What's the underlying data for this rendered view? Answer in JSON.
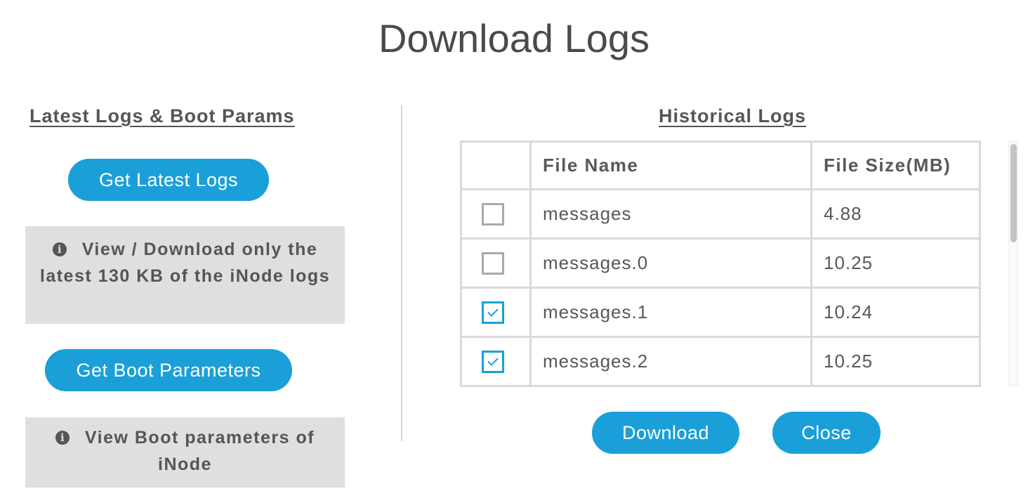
{
  "page": {
    "title": "Download Logs"
  },
  "left": {
    "heading": "Latest Logs & Boot Params",
    "get_latest_logs_label": "Get Latest Logs",
    "latest_info_text": "View / Download only the latest 130 KB of the iNode logs",
    "get_boot_params_label": "Get Boot Parameters",
    "boot_info_text": "View Boot parameters of iNode",
    "info_icon": "info-icon"
  },
  "right": {
    "heading": "Historical Logs",
    "columns": {
      "file_name": "File Name",
      "file_size": "File Size(MB)"
    },
    "rows": [
      {
        "name": "messages",
        "size": "4.88",
        "checked": false
      },
      {
        "name": "messages.0",
        "size": "10.25",
        "checked": false
      },
      {
        "name": "messages.1",
        "size": "10.24",
        "checked": true
      },
      {
        "name": "messages.2",
        "size": "10.25",
        "checked": true
      }
    ],
    "scroll_position": 0
  },
  "actions": {
    "download_label": "Download",
    "close_label": "Close"
  },
  "colors": {
    "accent": "#1a9fd9",
    "info_bg": "#dfdfdf",
    "text": "#58585b"
  }
}
